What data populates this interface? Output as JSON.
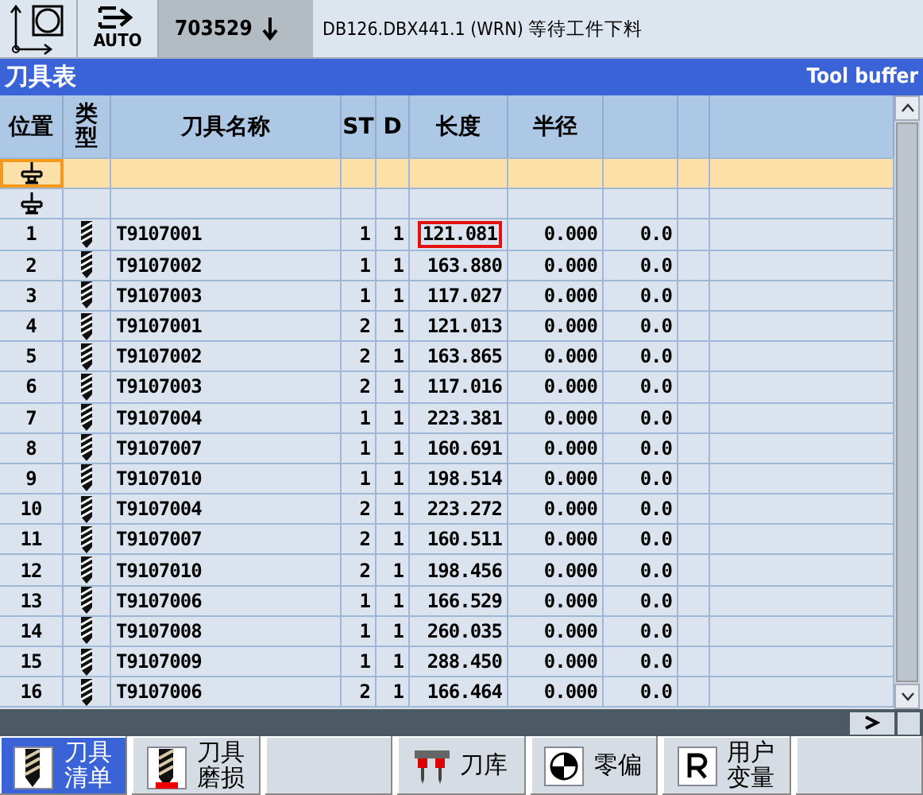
{
  "top_bar": {
    "mode": "AUTO",
    "program": "703529",
    "message": "DB126.DBX441.1 (WRN) 等待工件下料"
  },
  "window": {
    "title": "刀具表",
    "subtitle": "Tool buffer"
  },
  "table": {
    "columns": [
      "位置",
      "类型",
      "刀具名称",
      "ST",
      "D",
      "长度",
      "半径"
    ],
    "rows": [
      {
        "kind": "spindle",
        "selected": true
      },
      {
        "kind": "spindle",
        "selected": false
      },
      {
        "kind": "tool",
        "selected": false,
        "boxed": true,
        "location": "1",
        "name": "T9107001",
        "st": "1",
        "d": "1",
        "length": "121.081",
        "radius": "0.000",
        "column_8": "0.0"
      },
      {
        "kind": "tool",
        "selected": false,
        "boxed": false,
        "location": "2",
        "name": "T9107002",
        "st": "1",
        "d": "1",
        "length": "163.880",
        "radius": "0.000",
        "column_8": "0.0"
      },
      {
        "kind": "tool",
        "selected": false,
        "boxed": false,
        "location": "3",
        "name": "T9107003",
        "st": "1",
        "d": "1",
        "length": "117.027",
        "radius": "0.000",
        "column_8": "0.0"
      },
      {
        "kind": "tool",
        "selected": false,
        "boxed": false,
        "location": "4",
        "name": "T9107001",
        "st": "2",
        "d": "1",
        "length": "121.013",
        "radius": "0.000",
        "column_8": "0.0"
      },
      {
        "kind": "tool",
        "selected": false,
        "boxed": false,
        "location": "5",
        "name": "T9107002",
        "st": "2",
        "d": "1",
        "length": "163.865",
        "radius": "0.000",
        "column_8": "0.0"
      },
      {
        "kind": "tool",
        "selected": false,
        "boxed": false,
        "location": "6",
        "name": "T9107003",
        "st": "2",
        "d": "1",
        "length": "117.016",
        "radius": "0.000",
        "column_8": "0.0"
      },
      {
        "kind": "tool",
        "selected": false,
        "boxed": false,
        "location": "7",
        "name": "T9107004",
        "st": "1",
        "d": "1",
        "length": "223.381",
        "radius": "0.000",
        "column_8": "0.0"
      },
      {
        "kind": "tool",
        "selected": false,
        "boxed": false,
        "location": "8",
        "name": "T9107007",
        "st": "1",
        "d": "1",
        "length": "160.691",
        "radius": "0.000",
        "column_8": "0.0"
      },
      {
        "kind": "tool",
        "selected": false,
        "boxed": false,
        "location": "9",
        "name": "T9107010",
        "st": "1",
        "d": "1",
        "length": "198.514",
        "radius": "0.000",
        "column_8": "0.0"
      },
      {
        "kind": "tool",
        "selected": false,
        "boxed": false,
        "location": "10",
        "name": "T9107004",
        "st": "2",
        "d": "1",
        "length": "223.272",
        "radius": "0.000",
        "column_8": "0.0"
      },
      {
        "kind": "tool",
        "selected": false,
        "boxed": false,
        "location": "11",
        "name": "T9107007",
        "st": "2",
        "d": "1",
        "length": "160.511",
        "radius": "0.000",
        "column_8": "0.0"
      },
      {
        "kind": "tool",
        "selected": false,
        "boxed": false,
        "location": "12",
        "name": "T9107010",
        "st": "2",
        "d": "1",
        "length": "198.456",
        "radius": "0.000",
        "column_8": "0.0"
      },
      {
        "kind": "tool",
        "selected": false,
        "boxed": false,
        "location": "13",
        "name": "T9107006",
        "st": "1",
        "d": "1",
        "length": "166.529",
        "radius": "0.000",
        "column_8": "0.0"
      },
      {
        "kind": "tool",
        "selected": false,
        "boxed": false,
        "location": "14",
        "name": "T9107008",
        "st": "1",
        "d": "1",
        "length": "260.035",
        "radius": "0.000",
        "column_8": "0.0"
      },
      {
        "kind": "tool",
        "selected": false,
        "boxed": false,
        "location": "15",
        "name": "T9107009",
        "st": "1",
        "d": "1",
        "length": "288.450",
        "radius": "0.000",
        "column_8": "0.0"
      },
      {
        "kind": "tool",
        "selected": false,
        "boxed": false,
        "location": "16",
        "name": "T9107006",
        "st": "2",
        "d": "1",
        "length": "166.464",
        "radius": "0.000",
        "column_8": "0.0"
      }
    ]
  },
  "softkeys": [
    {
      "kind": "tool-list",
      "label": "刀具清单",
      "selected": true
    },
    {
      "kind": "tool-wear",
      "label": "刀具磨损",
      "selected": false
    },
    {
      "kind": "empty",
      "selected": false
    },
    {
      "kind": "magazine",
      "label": "刀库",
      "selected": false
    },
    {
      "kind": "work-offset",
      "label": "零偏",
      "selected": false
    },
    {
      "kind": "user-variables",
      "label": "用户变量",
      "selected": false
    },
    {
      "kind": "empty",
      "selected": false
    }
  ]
}
